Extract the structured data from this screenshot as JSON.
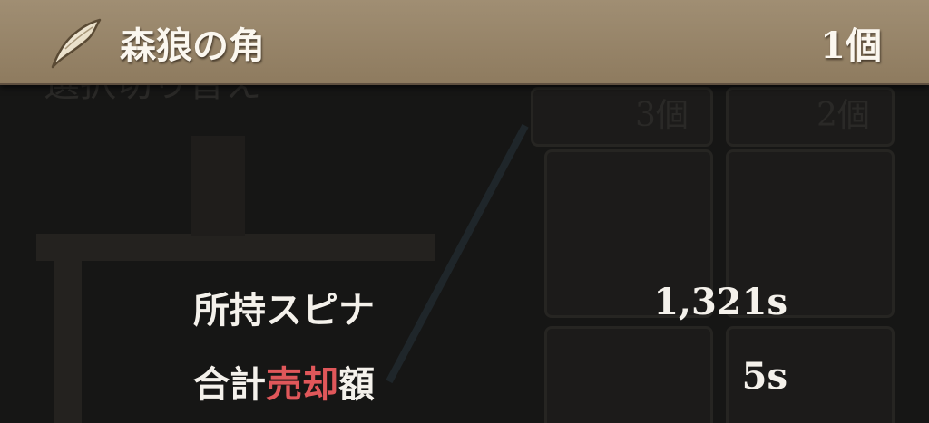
{
  "item": {
    "icon": "wolf-horn-icon",
    "name": "森狼の角",
    "quantity": "1個"
  },
  "background": {
    "ghost_header": "選択切り替え",
    "slot_counts": [
      "3個",
      "2個"
    ]
  },
  "summary": {
    "owned_label": "所持スピナ",
    "owned_value": "1,321s",
    "total_label_prefix": "合計",
    "total_label_accent": "売却",
    "total_label_suffix": "額",
    "total_value": "5s"
  },
  "colors": {
    "bar": "#9b8a6e",
    "text": "#fbf7ef",
    "accent": "#e0575a"
  }
}
